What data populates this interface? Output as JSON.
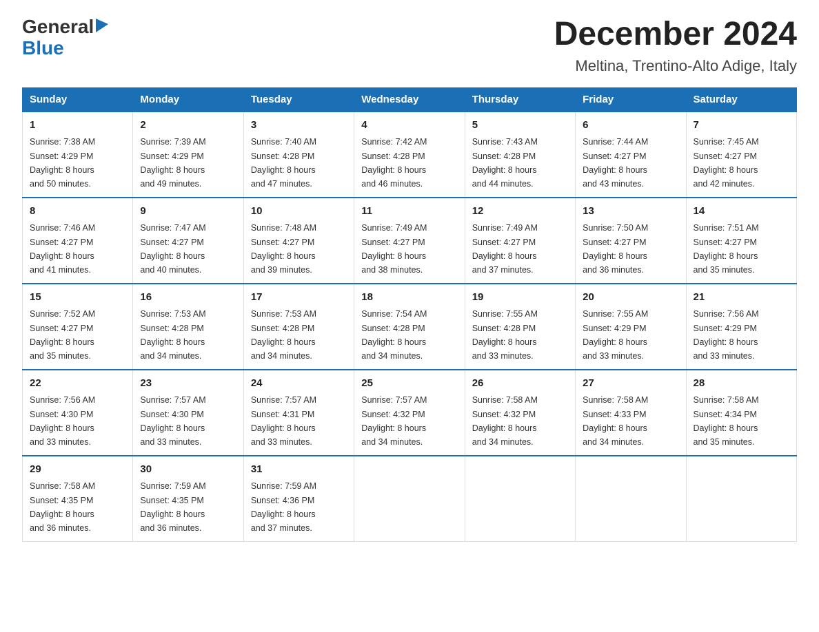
{
  "header": {
    "logo_general": "General",
    "logo_blue": "Blue",
    "title": "December 2024",
    "subtitle": "Meltina, Trentino-Alto Adige, Italy"
  },
  "weekdays": [
    "Sunday",
    "Monday",
    "Tuesday",
    "Wednesday",
    "Thursday",
    "Friday",
    "Saturday"
  ],
  "weeks": [
    [
      {
        "day": "1",
        "sunrise": "7:38 AM",
        "sunset": "4:29 PM",
        "daylight": "8 hours and 50 minutes."
      },
      {
        "day": "2",
        "sunrise": "7:39 AM",
        "sunset": "4:29 PM",
        "daylight": "8 hours and 49 minutes."
      },
      {
        "day": "3",
        "sunrise": "7:40 AM",
        "sunset": "4:28 PM",
        "daylight": "8 hours and 47 minutes."
      },
      {
        "day": "4",
        "sunrise": "7:42 AM",
        "sunset": "4:28 PM",
        "daylight": "8 hours and 46 minutes."
      },
      {
        "day": "5",
        "sunrise": "7:43 AM",
        "sunset": "4:28 PM",
        "daylight": "8 hours and 44 minutes."
      },
      {
        "day": "6",
        "sunrise": "7:44 AM",
        "sunset": "4:27 PM",
        "daylight": "8 hours and 43 minutes."
      },
      {
        "day": "7",
        "sunrise": "7:45 AM",
        "sunset": "4:27 PM",
        "daylight": "8 hours and 42 minutes."
      }
    ],
    [
      {
        "day": "8",
        "sunrise": "7:46 AM",
        "sunset": "4:27 PM",
        "daylight": "8 hours and 41 minutes."
      },
      {
        "day": "9",
        "sunrise": "7:47 AM",
        "sunset": "4:27 PM",
        "daylight": "8 hours and 40 minutes."
      },
      {
        "day": "10",
        "sunrise": "7:48 AM",
        "sunset": "4:27 PM",
        "daylight": "8 hours and 39 minutes."
      },
      {
        "day": "11",
        "sunrise": "7:49 AM",
        "sunset": "4:27 PM",
        "daylight": "8 hours and 38 minutes."
      },
      {
        "day": "12",
        "sunrise": "7:49 AM",
        "sunset": "4:27 PM",
        "daylight": "8 hours and 37 minutes."
      },
      {
        "day": "13",
        "sunrise": "7:50 AM",
        "sunset": "4:27 PM",
        "daylight": "8 hours and 36 minutes."
      },
      {
        "day": "14",
        "sunrise": "7:51 AM",
        "sunset": "4:27 PM",
        "daylight": "8 hours and 35 minutes."
      }
    ],
    [
      {
        "day": "15",
        "sunrise": "7:52 AM",
        "sunset": "4:27 PM",
        "daylight": "8 hours and 35 minutes."
      },
      {
        "day": "16",
        "sunrise": "7:53 AM",
        "sunset": "4:28 PM",
        "daylight": "8 hours and 34 minutes."
      },
      {
        "day": "17",
        "sunrise": "7:53 AM",
        "sunset": "4:28 PM",
        "daylight": "8 hours and 34 minutes."
      },
      {
        "day": "18",
        "sunrise": "7:54 AM",
        "sunset": "4:28 PM",
        "daylight": "8 hours and 34 minutes."
      },
      {
        "day": "19",
        "sunrise": "7:55 AM",
        "sunset": "4:28 PM",
        "daylight": "8 hours and 33 minutes."
      },
      {
        "day": "20",
        "sunrise": "7:55 AM",
        "sunset": "4:29 PM",
        "daylight": "8 hours and 33 minutes."
      },
      {
        "day": "21",
        "sunrise": "7:56 AM",
        "sunset": "4:29 PM",
        "daylight": "8 hours and 33 minutes."
      }
    ],
    [
      {
        "day": "22",
        "sunrise": "7:56 AM",
        "sunset": "4:30 PM",
        "daylight": "8 hours and 33 minutes."
      },
      {
        "day": "23",
        "sunrise": "7:57 AM",
        "sunset": "4:30 PM",
        "daylight": "8 hours and 33 minutes."
      },
      {
        "day": "24",
        "sunrise": "7:57 AM",
        "sunset": "4:31 PM",
        "daylight": "8 hours and 33 minutes."
      },
      {
        "day": "25",
        "sunrise": "7:57 AM",
        "sunset": "4:32 PM",
        "daylight": "8 hours and 34 minutes."
      },
      {
        "day": "26",
        "sunrise": "7:58 AM",
        "sunset": "4:32 PM",
        "daylight": "8 hours and 34 minutes."
      },
      {
        "day": "27",
        "sunrise": "7:58 AM",
        "sunset": "4:33 PM",
        "daylight": "8 hours and 34 minutes."
      },
      {
        "day": "28",
        "sunrise": "7:58 AM",
        "sunset": "4:34 PM",
        "daylight": "8 hours and 35 minutes."
      }
    ],
    [
      {
        "day": "29",
        "sunrise": "7:58 AM",
        "sunset": "4:35 PM",
        "daylight": "8 hours and 36 minutes."
      },
      {
        "day": "30",
        "sunrise": "7:59 AM",
        "sunset": "4:35 PM",
        "daylight": "8 hours and 36 minutes."
      },
      {
        "day": "31",
        "sunrise": "7:59 AM",
        "sunset": "4:36 PM",
        "daylight": "8 hours and 37 minutes."
      },
      null,
      null,
      null,
      null
    ]
  ],
  "labels": {
    "sunrise": "Sunrise:",
    "sunset": "Sunset:",
    "daylight": "Daylight:"
  }
}
